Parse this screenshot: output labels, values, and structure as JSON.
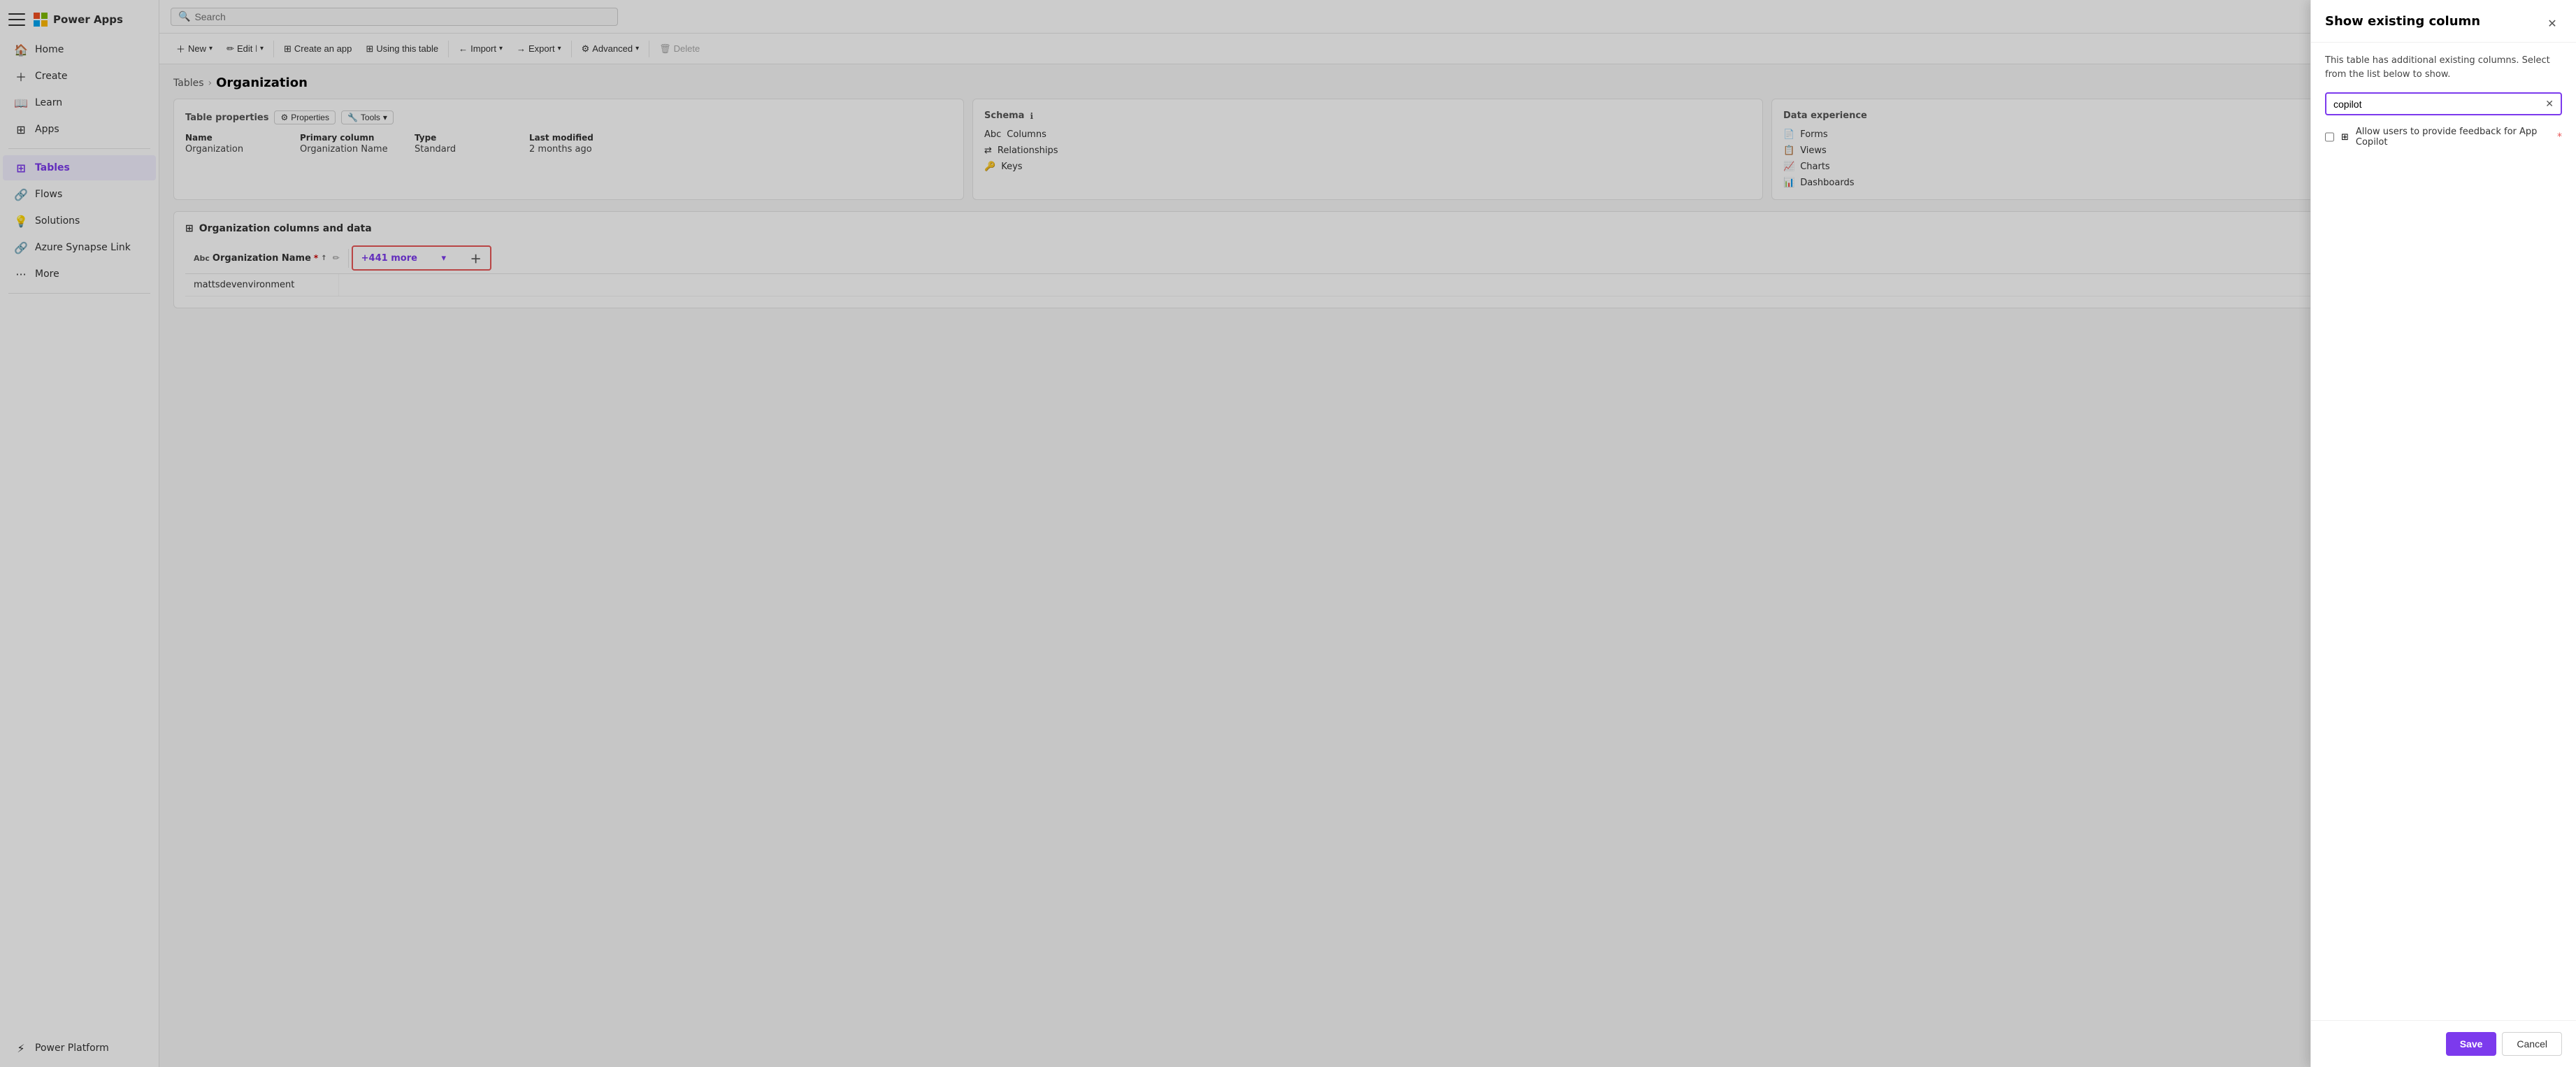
{
  "brand": {
    "name": "Power Apps"
  },
  "sidebar": {
    "hamburger_label": "Menu",
    "items": [
      {
        "id": "home",
        "label": "Home",
        "icon": "🏠"
      },
      {
        "id": "create",
        "label": "Create",
        "icon": "➕"
      },
      {
        "id": "learn",
        "label": "Learn",
        "icon": "📖"
      },
      {
        "id": "apps",
        "label": "Apps",
        "icon": "⊞"
      },
      {
        "id": "tables",
        "label": "Tables",
        "icon": "⊞",
        "active": true
      },
      {
        "id": "flows",
        "label": "Flows",
        "icon": "🔗"
      },
      {
        "id": "solutions",
        "label": "Solutions",
        "icon": "💡"
      },
      {
        "id": "azure-synapse",
        "label": "Azure Synapse Link",
        "icon": "🔗"
      },
      {
        "id": "more",
        "label": "More",
        "icon": "···"
      },
      {
        "id": "power-platform",
        "label": "Power Platform",
        "icon": "⚡"
      }
    ]
  },
  "topbar": {
    "search_placeholder": "Search"
  },
  "cmdbar": {
    "new_label": "New",
    "edit_label": "Edit",
    "create_app_label": "Create an app",
    "using_this_table_label": "Using this table",
    "import_label": "Import",
    "export_label": "Export",
    "advanced_label": "Advanced",
    "delete_label": "Delete"
  },
  "breadcrumb": {
    "tables_label": "Tables",
    "current": "Organization"
  },
  "table_properties": {
    "title": "Table properties",
    "name_label": "Name",
    "name_value": "Organization",
    "primary_column_label": "Primary column",
    "primary_column_value": "Organization Name",
    "type_label": "Type",
    "type_value": "Standard",
    "last_modified_label": "Last modified",
    "last_modified_value": "2 months ago"
  },
  "properties_btn": "Properties",
  "tools_btn": "Tools",
  "schema": {
    "title": "Schema",
    "info_icon": "ℹ",
    "items": [
      {
        "label": "Columns",
        "icon": "Abc"
      },
      {
        "label": "Relationships",
        "icon": "⇄"
      },
      {
        "label": "Keys",
        "icon": "🔑"
      }
    ]
  },
  "data_experience": {
    "title": "Data experience",
    "items": [
      {
        "label": "Forms",
        "icon": "📄"
      },
      {
        "label": "Views",
        "icon": "📋"
      },
      {
        "label": "Charts",
        "icon": "📈"
      },
      {
        "label": "Dashboards",
        "icon": "📊"
      }
    ]
  },
  "org_columns": {
    "title": "Organization columns and data",
    "org_name_col": "Organization Name",
    "sort_icon": "↑",
    "more_cols_label": "+441 more",
    "add_col_label": "+",
    "data_row": "mattsdevenvironment"
  },
  "panel": {
    "title": "Show existing column",
    "description": "This table has additional existing columns. Select from the list below to show.",
    "close_label": "✕",
    "search_value": "copilot",
    "search_clear": "✕",
    "checkbox_label": "Allow users to provide feedback for App Copilot",
    "required_marker": "*",
    "copilot_icon": "⊞",
    "save_label": "Save",
    "cancel_label": "Cancel"
  }
}
